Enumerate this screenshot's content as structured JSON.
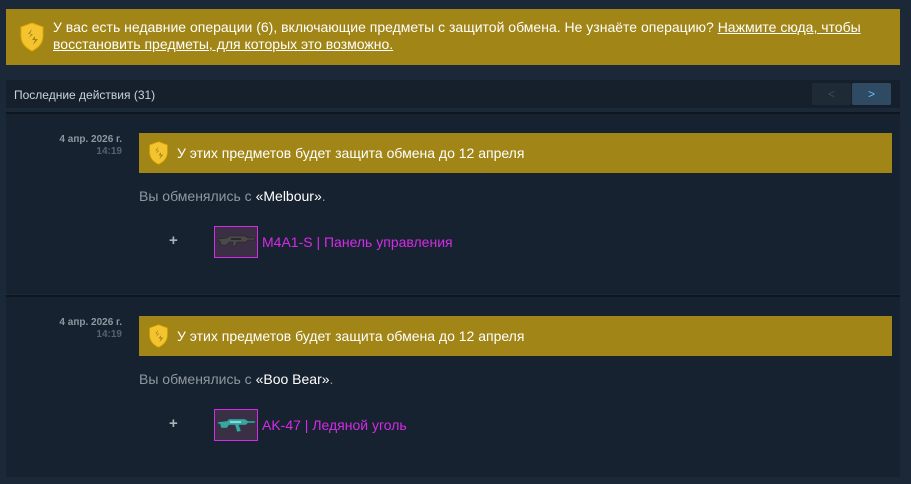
{
  "banner": {
    "text": "У вас есть недавние операции (6), включающие предметы с защитой обмена. Не узнаёте операцию? ",
    "link_text": "Нажмите сюда, чтобы восстановить предметы, для которых это возможно."
  },
  "history": {
    "title": "Последние действия (31)",
    "prev_label": "<",
    "next_label": ">"
  },
  "entries": [
    {
      "date": "4 апр. 2026 г.",
      "time": "14:19",
      "protection_text": "У этих предметов будет защита обмена до 12 апреля",
      "traded_prefix": "Вы обменялись с ",
      "partner": "«Melbour»",
      "traded_suffix": ".",
      "plus": "+",
      "item_name": "M4A1-S | Панель управления"
    },
    {
      "date": "4 апр. 2026 г.",
      "time": "14:19",
      "protection_text": "У этих предметов будет защита обмена до 12 апреля",
      "traded_prefix": "Вы обменялись с ",
      "partner": "«Boo Bear»",
      "traded_suffix": ".",
      "plus": "+",
      "item_name": "AK-47 | Ледяной уголь"
    }
  ],
  "colors": {
    "background": "#1b2838",
    "banner": "#a18516",
    "item_rarity": "#d32ce6"
  },
  "icons": {
    "shield": "shield-icon",
    "rifle_m4": "m4a1s-rifle-icon",
    "rifle_ak": "ak47-rifle-icon"
  }
}
